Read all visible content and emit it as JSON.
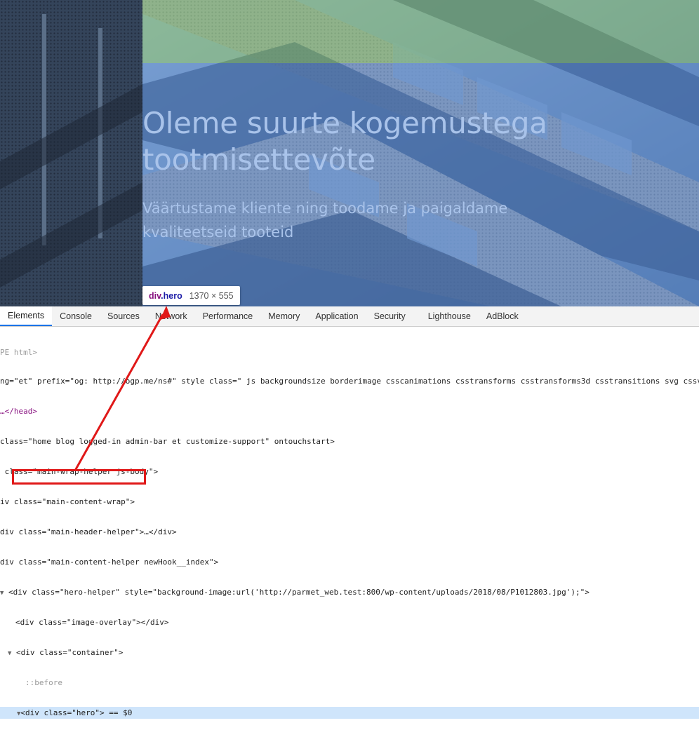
{
  "hero": {
    "title_line1": "Oleme suurte kogemustega",
    "title_line2": "tootmisettevõte",
    "subtitle_line1": "Väärtustame kliente ning toodame ja paigaldame",
    "subtitle_line2": "kvaliteetseid tooteid"
  },
  "tooltip": {
    "tag": "div",
    "class": ".hero",
    "dimensions": "1370 × 555"
  },
  "devtools": {
    "tabs": [
      {
        "label": "Elements",
        "active": true
      },
      {
        "label": "Console"
      },
      {
        "label": "Sources"
      },
      {
        "label": "Network"
      },
      {
        "label": "Performance"
      },
      {
        "label": "Memory"
      },
      {
        "label": "Application"
      },
      {
        "label": "Security"
      },
      {
        "label": "Lighthouse"
      },
      {
        "label": "AdBlock"
      }
    ],
    "lines": {
      "l0": "PE html>",
      "l1a": "ng=\"et\" prefix=\"og: http://ogp.me/ns#\" style class=\" js backgroundsize borderimage csscanimations csstransforms csstransforms3d csstransitions svg cssvh",
      "l2": "…</head>",
      "l3": "class=\"home blog logged-in admin-bar et customize-support\" ontouchstart>",
      "l4": " class=\"main-wrap-helper js-body\">",
      "l5": "iv class=\"main-content-wrap\">",
      "l6": "div class=\"main-header-helper\">…</div>",
      "l7": "div class=\"main-content-helper newHook__index\">",
      "l8": "<div class=\"hero-helper\" style=\"background-image:url('http://parmet_web.test:800/wp-content/uploads/2018/08/P1012803.jpg');\">",
      "l9": "<div class=\"image-overlay\"></div>",
      "l10": "<div class=\"container\">",
      "l11": "::before",
      "l12": "<div class=\"hero\"> == $0"
    }
  },
  "colors": {
    "hero_text": "#a9c3ea",
    "overlay_blue": "#4a72b8",
    "overlay_green": "#7cae5a",
    "highlight": "#cfe5fb",
    "annotation_red": "#e01818"
  }
}
